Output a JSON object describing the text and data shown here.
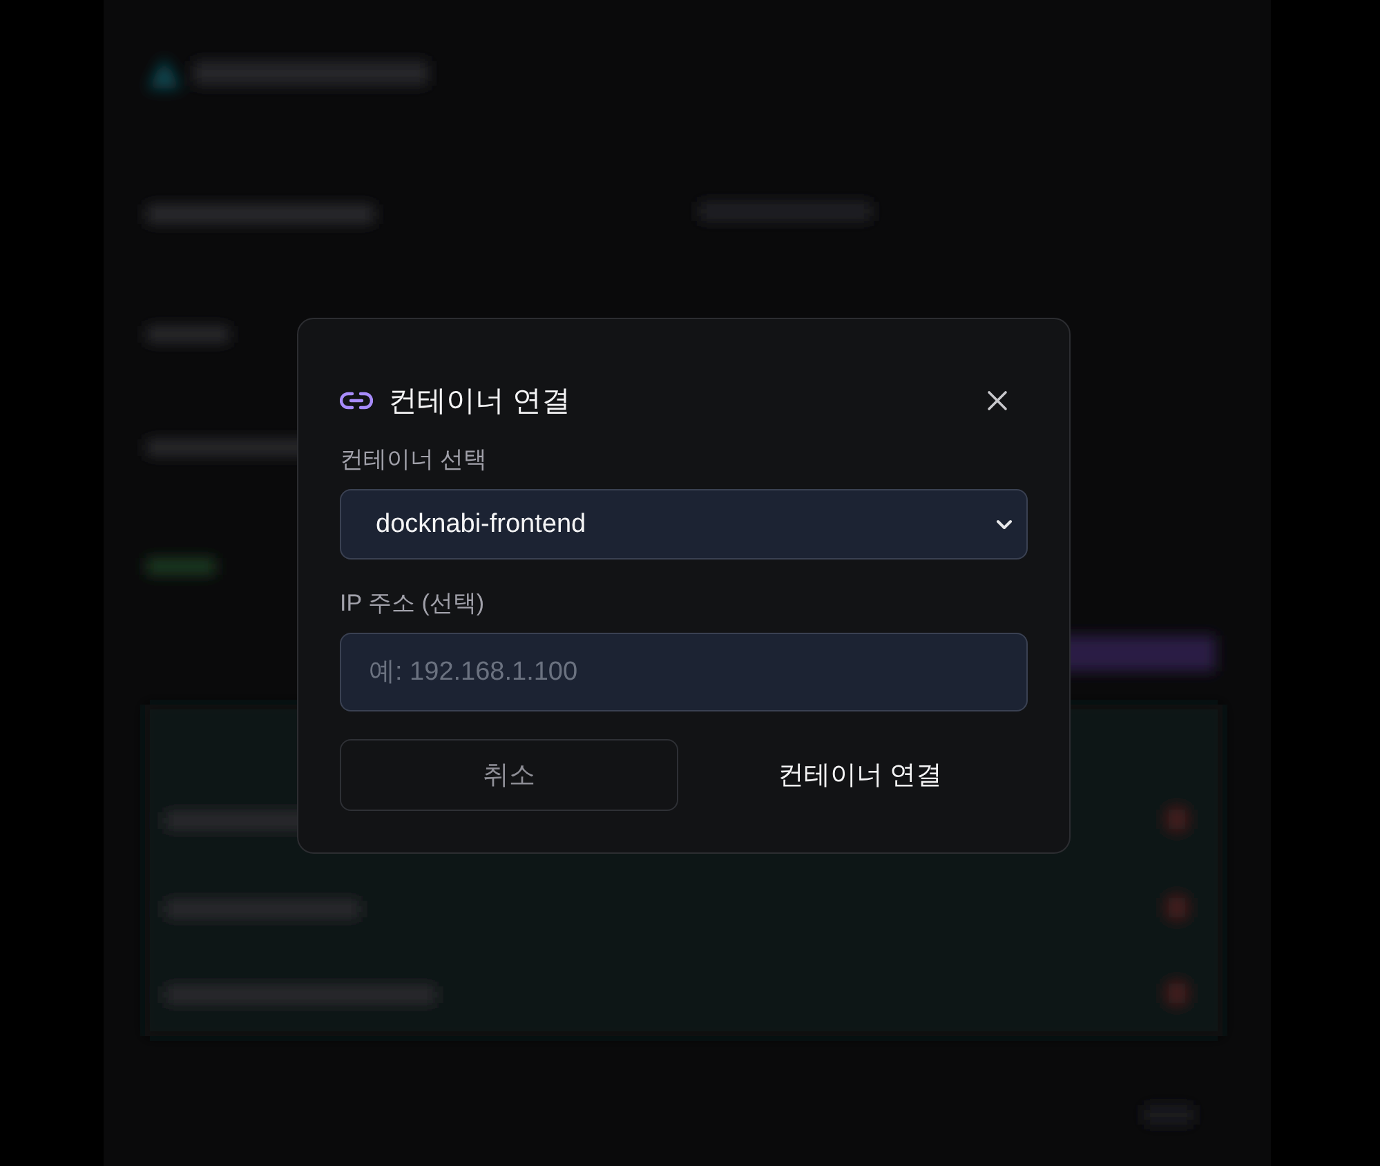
{
  "dialog": {
    "title": "컨테이너 연결",
    "fields": [
      {
        "kind": "select",
        "label": "컨테이너 선택",
        "value": "docknabi-frontend"
      },
      {
        "kind": "text",
        "label": "IP 주소 (선택)",
        "placeholder": "예: 192.168.1.100"
      }
    ],
    "buttons": [
      {
        "kind": "secondary",
        "label": "취소"
      },
      {
        "kind": "primary",
        "label": "컨테이너 연결"
      }
    ]
  }
}
